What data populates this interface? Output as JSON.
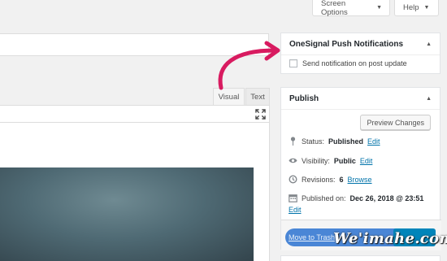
{
  "header": {
    "screen_options_label": "Screen Options",
    "help_label": "Help"
  },
  "editor": {
    "tab_visual": "Visual",
    "tab_text": "Text"
  },
  "onesignal": {
    "title": "OneSignal Push Notifications",
    "checkbox_label": "Send notification on post update",
    "checked": false
  },
  "publish": {
    "title": "Publish",
    "preview_label": "Preview Changes",
    "status_label": "Status:",
    "status_value": "Published",
    "visibility_label": "Visibility:",
    "visibility_value": "Public",
    "revisions_label": "Revisions:",
    "revisions_value": "6",
    "browse_label": "Browse",
    "published_on_label": "Published on:",
    "published_on_value": "Dec 26, 2018 @ 23:51",
    "edit_label": "Edit",
    "move_trash_label": "Move to Trash"
  },
  "watermark": "We'imahe.com",
  "colors": {
    "link": "#0073aa",
    "arrow": "#d81b60",
    "primary_button": "#0085ba"
  }
}
